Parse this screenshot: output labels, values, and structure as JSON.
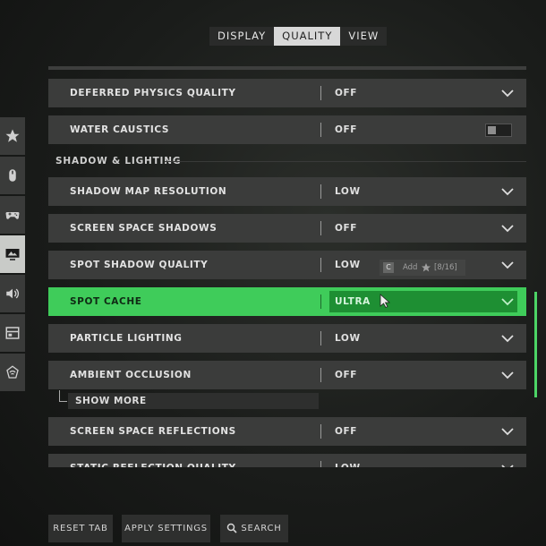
{
  "tabs": [
    {
      "label": "DISPLAY"
    },
    {
      "label": "QUALITY",
      "active": true
    },
    {
      "label": "VIEW"
    }
  ],
  "rail_icons": [
    "star-icon",
    "mouse-icon",
    "gamepad-icon",
    "monitor-icon",
    "speaker-icon",
    "interface-icon",
    "network-icon"
  ],
  "rows": {
    "deferred_physics": {
      "label": "DEFERRED PHYSICS QUALITY",
      "value": "OFF"
    },
    "water_caustics": {
      "label": "WATER CAUSTICS",
      "value": "OFF"
    },
    "section_title": "SHADOW & LIGHTING",
    "shadow_map": {
      "label": "SHADOW MAP RESOLUTION",
      "value": "LOW"
    },
    "screen_space_shadows": {
      "label": "SCREEN SPACE SHADOWS",
      "value": "OFF"
    },
    "spot_shadow": {
      "label": "SPOT SHADOW QUALITY",
      "value": "LOW"
    },
    "spot_cache": {
      "label": "SPOT CACHE",
      "value": "ULTRA"
    },
    "particle_lighting": {
      "label": "PARTICLE LIGHTING",
      "value": "LOW"
    },
    "ambient_occlusion": {
      "label": "AMBIENT OCCLUSION",
      "value": "OFF"
    },
    "show_more": "SHOW MORE",
    "ssr": {
      "label": "SCREEN SPACE REFLECTIONS",
      "value": "OFF"
    },
    "static_reflection": {
      "label": "STATIC REFLECTION QUALITY",
      "value": "LOW"
    }
  },
  "tooltip": {
    "key": "C",
    "action": "Add",
    "count": "[8/16]"
  },
  "bottom": {
    "reset": "RESET TAB",
    "apply": "APPLY SETTINGS",
    "search": "SEARCH"
  },
  "colors": {
    "accent": "#3fcc5a",
    "accent_dark": "#1e8f33"
  }
}
